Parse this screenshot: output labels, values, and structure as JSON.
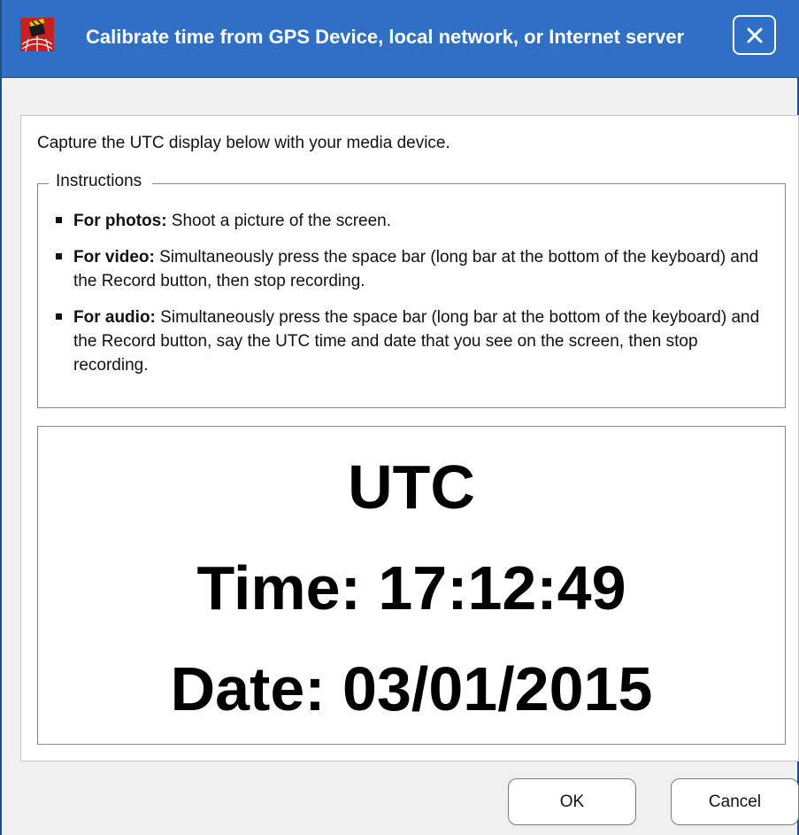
{
  "window": {
    "title": "Calibrate time from GPS Device, local network, or Internet server",
    "app_icon": "film-clapper-globe-icon",
    "close_icon": "close-icon"
  },
  "intro_text": "Capture the UTC display below with your media device.",
  "instructions": {
    "legend": "Instructions",
    "items": [
      {
        "label": "For photos:",
        "text": " Shoot a picture of the screen."
      },
      {
        "label": "For video:",
        "text": " Simultaneously press the space bar (long bar at the bottom of the keyboard) and the Record button, then stop recording."
      },
      {
        "label": "For audio:",
        "text": " Simultaneously press the space bar (long bar at the bottom of the keyboard) and the Record button, say the UTC time and date that you see on the screen, then stop recording."
      }
    ]
  },
  "utc_display": {
    "heading": "UTC",
    "time": "Time: 17:12:49",
    "date": "Date: 03/01/2015"
  },
  "buttons": {
    "ok": "OK",
    "cancel": "Cancel"
  },
  "colors": {
    "titlebar": "#2f6fc6",
    "window_border": "#1e4e8a",
    "background": "#f0f0f0",
    "panel": "#ffffff"
  }
}
